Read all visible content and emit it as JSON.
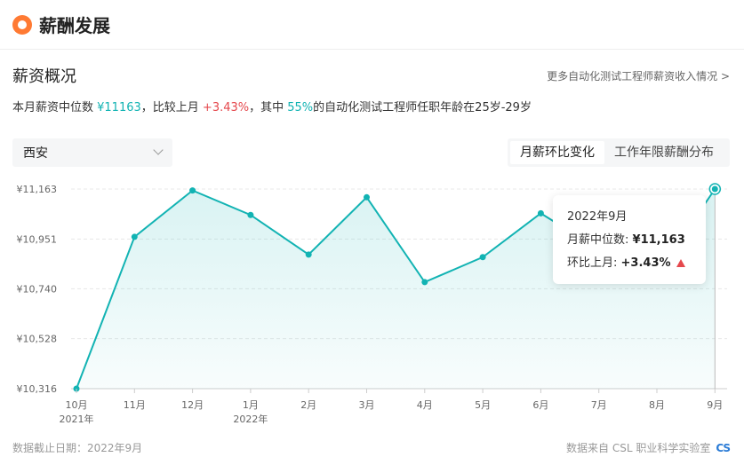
{
  "header": {
    "title": "薪酬发展"
  },
  "section": {
    "title": "薪资概况",
    "more_link": "更多自动化测试工程师薪资收入情况 >"
  },
  "summary": {
    "p1": "本月薪资中位数 ",
    "median": "¥11163",
    "p2": "，比较上月 ",
    "change": "+3.43%",
    "p3": "，其中 ",
    "percent": "55%",
    "p4": "的自动化测试工程师任职年龄在25岁-29岁"
  },
  "city_select": {
    "value": "西安"
  },
  "tabs": [
    {
      "label": "月薪环比变化",
      "active": true
    },
    {
      "label": "工作年限薪酬分布",
      "active": false
    }
  ],
  "tooltip": {
    "date": "2022年9月",
    "median_label": "月薪中位数:",
    "median_value": "¥11,163",
    "change_label": "环比上月:",
    "change_value": "+3.43%"
  },
  "chart_data": {
    "type": "area",
    "categories": [
      "10月",
      "11月",
      "12月",
      "1月",
      "2月",
      "3月",
      "4月",
      "5月",
      "6月",
      "7月",
      "8月",
      "9月"
    ],
    "year_labels": [
      "2021年",
      "",
      "",
      "2022年",
      "",
      "",
      "",
      "",
      "",
      "",
      "",
      ""
    ],
    "values": [
      10316,
      10960,
      11157,
      11053,
      10885,
      11128,
      10768,
      10874,
      11060,
      10906,
      10800,
      11163
    ],
    "y_ticks": [
      "¥10,316",
      "¥10,528",
      "¥10,740",
      "¥10,951",
      "¥11,163"
    ],
    "y_tick_values": [
      10316,
      10528,
      10740,
      10951,
      11163
    ],
    "ylim": [
      10316,
      11163
    ],
    "highlight_index": 11,
    "grid": true,
    "line_color": "#12b3b3"
  },
  "footer": {
    "left": "数据截止日期：2022年9月",
    "right": "数据来自 CSL 职业科学实验室",
    "logo_text": "CS"
  }
}
